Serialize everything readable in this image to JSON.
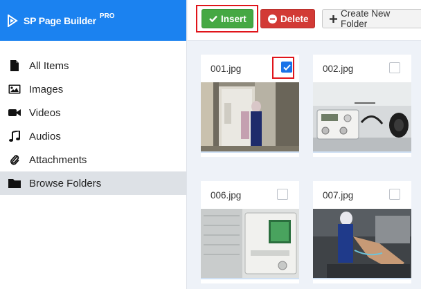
{
  "brand": {
    "name": "SP Page Builder",
    "badge": "PRO",
    "bg": "#1b82f0"
  },
  "sidebar": {
    "items": [
      {
        "label": "All Items",
        "icon": "file-icon"
      },
      {
        "label": "Images",
        "icon": "image-icon"
      },
      {
        "label": "Videos",
        "icon": "video-camera-icon"
      },
      {
        "label": "Audios",
        "icon": "music-note-icon"
      },
      {
        "label": "Attachments",
        "icon": "paperclip-icon"
      },
      {
        "label": "Browse Folders",
        "icon": "folder-icon",
        "active": true
      }
    ]
  },
  "toolbar": {
    "insert_label": "Insert",
    "delete_label": "Delete",
    "create_folder_label": "Create New Folder"
  },
  "files": [
    {
      "name": "001.jpg",
      "checked": true
    },
    {
      "name": "002.jpg",
      "checked": false
    },
    {
      "name": "006.jpg",
      "checked": false
    },
    {
      "name": "007.jpg",
      "checked": false
    }
  ],
  "colors": {
    "insert": "#45a843",
    "delete": "#d23a35",
    "checkbox": "#1a73e8",
    "highlight": "#e0141a"
  }
}
